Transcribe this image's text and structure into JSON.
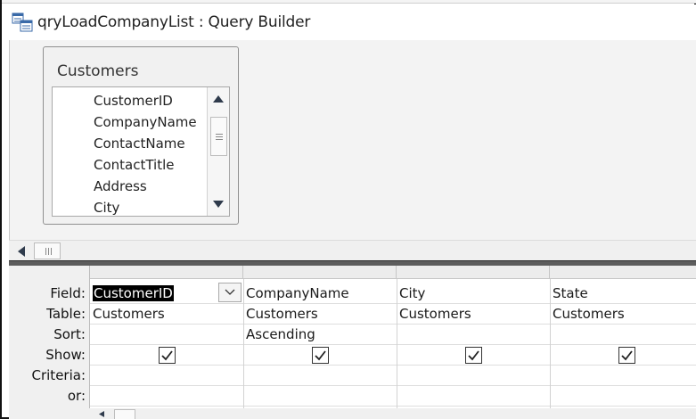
{
  "window": {
    "title": "qryLoadCompanyList : Query Builder"
  },
  "field_list": {
    "table_name": "Customers",
    "fields": [
      "CustomerID",
      "CompanyName",
      "ContactName",
      "ContactTitle",
      "Address",
      "City"
    ]
  },
  "grid": {
    "row_labels": {
      "field": "Field:",
      "table": "Table:",
      "sort": "Sort:",
      "show": "Show:",
      "criteria": "Criteria:",
      "or": "or:"
    },
    "columns": [
      {
        "field": "CustomerID",
        "table": "Customers",
        "sort": "",
        "show": true,
        "criteria": "",
        "or": ""
      },
      {
        "field": "CompanyName",
        "table": "Customers",
        "sort": "Ascending",
        "show": true,
        "criteria": "",
        "or": ""
      },
      {
        "field": "City",
        "table": "Customers",
        "sort": "",
        "show": true,
        "criteria": "",
        "or": ""
      },
      {
        "field": "State",
        "table": "Customers",
        "sort": "",
        "show": true,
        "criteria": "",
        "or": ""
      }
    ]
  },
  "icons": {
    "window": "query-builder-icon",
    "scroll_up": "triangle-up-icon",
    "scroll_down": "triangle-down-icon",
    "scroll_left": "triangle-left-icon",
    "dropdown": "chevron-down-icon",
    "checkbox": "check-icon"
  }
}
